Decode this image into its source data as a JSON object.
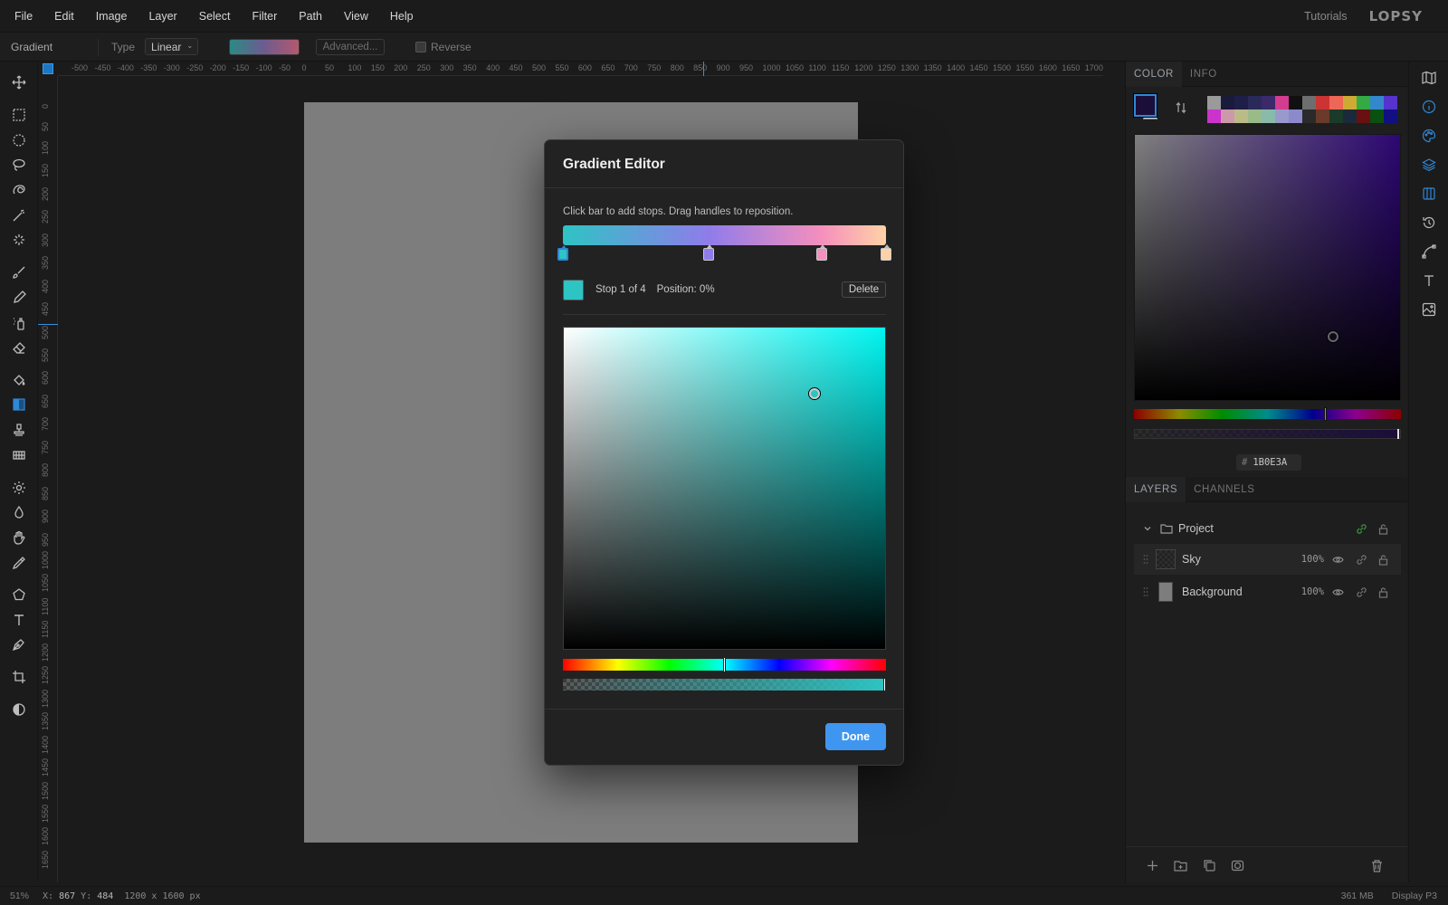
{
  "menubar": {
    "items": [
      "File",
      "Edit",
      "Image",
      "Layer",
      "Select",
      "Filter",
      "Path",
      "View",
      "Help"
    ],
    "tutorials": "Tutorials",
    "logo": "LOPSY"
  },
  "options": {
    "tool_name": "Gradient",
    "type_label": "Type",
    "type_value": "Linear",
    "advanced_label": "Advanced...",
    "reverse_label": "Reverse",
    "reverse_checked": false
  },
  "rulers": {
    "horizontal": [
      "-500",
      "-450",
      "-400",
      "-350",
      "-300",
      "-250",
      "-200",
      "-150",
      "-100",
      "-50",
      "0",
      "50",
      "100",
      "150",
      "200",
      "250",
      "300",
      "350",
      "400",
      "450",
      "500",
      "550",
      "600",
      "650",
      "700",
      "750",
      "800",
      "850",
      "900",
      "950",
      "1000",
      "1050",
      "1100",
      "1150",
      "1200",
      "1250",
      "1300",
      "1350",
      "1400",
      "1450",
      "1500",
      "1550",
      "1600",
      "1650",
      "1700",
      "17"
    ],
    "vertical": [
      "0",
      "50",
      "100",
      "150",
      "200",
      "250",
      "300",
      "350",
      "400",
      "450",
      "500",
      "550",
      "600",
      "650",
      "700",
      "750",
      "800",
      "850",
      "900",
      "950",
      "1000",
      "1050",
      "1100",
      "1150",
      "1200",
      "1250",
      "1300",
      "1350",
      "1400",
      "1450",
      "1500",
      "1550",
      "1600",
      "1650"
    ]
  },
  "color_panel": {
    "tabs": [
      "COLOR",
      "INFO"
    ],
    "active_tab": "COLOR",
    "foreground": "#1b0e3a",
    "background": "#cfcfcf",
    "hex_value": "1B0E3A",
    "swatches_row1": [
      "#9a9a9a",
      "#1a1a3a",
      "#1e1e48",
      "#2a2a5a",
      "#3a2a6a",
      "#d23d8f",
      "#101010",
      "#6e6e6e",
      "#c33",
      "#e65",
      "#ca3",
      "#3a4",
      "#38c",
      "#53c"
    ],
    "swatches_row2": [
      "#c3c",
      "#c9a",
      "#bb8",
      "#9b8",
      "#8ba",
      "#99c",
      "#8a8acc",
      "#2a2a2a",
      "#6a3a2a",
      "#1a3a2a",
      "#1a2a3a",
      "#6a1010",
      "#0a5010",
      "#101080"
    ]
  },
  "layers_panel": {
    "tabs": [
      "LAYERS",
      "CHANNELS"
    ],
    "active_tab": "LAYERS",
    "group": {
      "name": "Project"
    },
    "layers": [
      {
        "name": "Sky",
        "opacity": "100%",
        "selected": true
      },
      {
        "name": "Background",
        "opacity": "100%",
        "selected": false
      }
    ]
  },
  "status": {
    "zoom": "51%",
    "x_label": "X:",
    "x_value": "867",
    "y_label": "Y:",
    "y_value": "484",
    "doc_size": "1200 x 1600 px",
    "memory": "361 MB",
    "profile": "Display P3"
  },
  "gradient_editor": {
    "title": "Gradient Editor",
    "hint": "Click bar to add stops. Drag handles to reposition.",
    "stops": [
      {
        "color": "#2ec4c4",
        "position": 0
      },
      {
        "color": "#8f7cea",
        "position": 45
      },
      {
        "color": "#f58fbd",
        "position": 80
      },
      {
        "color": "#ffd2a6",
        "position": 100
      }
    ],
    "selected_stop_label": "Stop 1 of 4",
    "position_label": "Position: 0%",
    "delete_label": "Delete",
    "selected_color": "#2ec4c4",
    "done_label": "Done"
  }
}
